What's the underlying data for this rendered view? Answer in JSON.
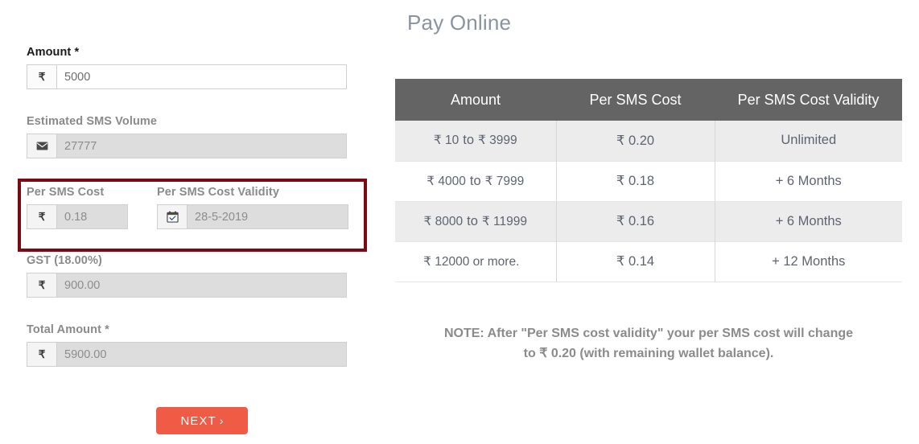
{
  "form": {
    "amount": {
      "label": "Amount *",
      "icon": "rupee-icon",
      "value": "5000",
      "editable": true
    },
    "sms_volume": {
      "label": "Estimated SMS Volume",
      "icon": "envelope-icon",
      "value": "27777",
      "editable": false
    },
    "per_sms_cost": {
      "label": "Per SMS Cost",
      "icon": "rupee-icon",
      "value": "0.18",
      "editable": false
    },
    "per_sms_cost_validity": {
      "label": "Per SMS Cost Validity",
      "icon": "calendar-icon",
      "value": "28-5-2019",
      "editable": false
    },
    "gst": {
      "label": "GST (18.00%)",
      "icon": "rupee-icon",
      "value": "900.00",
      "editable": false
    },
    "total_amount": {
      "label": "Total Amount *",
      "icon": "rupee-icon",
      "value": "5900.00",
      "editable": false
    },
    "next_button": {
      "label": "NEXT",
      "chevron": "›"
    },
    "highlight_color": "#7c0a15",
    "next_button_color": "#ef5b45"
  },
  "right_panel": {
    "title": "Pay Online",
    "table": {
      "headers": [
        "Amount",
        "Per SMS Cost",
        "Per SMS Cost Validity"
      ],
      "header_bg": "#646464",
      "rows": [
        {
          "amount_from": "₹ 10",
          "amount_to_word": "to",
          "amount_upto": "₹ 3999",
          "per_sms_cost": "₹ 0.20",
          "validity": "Unlimited"
        },
        {
          "amount_from": "₹ 4000",
          "amount_to_word": "to",
          "amount_upto": "₹ 7999",
          "per_sms_cost": "₹ 0.18",
          "validity": "+ 6 Months"
        },
        {
          "amount_from": "₹ 8000",
          "amount_to_word": "to",
          "amount_upto": "₹ 11999",
          "per_sms_cost": "₹ 0.16",
          "validity": "+ 6 Months"
        },
        {
          "amount_from": "₹ 12000 or more.",
          "amount_to_word": "",
          "amount_upto": "",
          "per_sms_cost": "₹ 0.14",
          "validity": "+ 12 Months"
        }
      ]
    },
    "note_line1": "NOTE: After \"Per SMS cost validity\" your per SMS cost will change",
    "note_line2": "to ₹ 0.20 (with remaining wallet balance)."
  }
}
